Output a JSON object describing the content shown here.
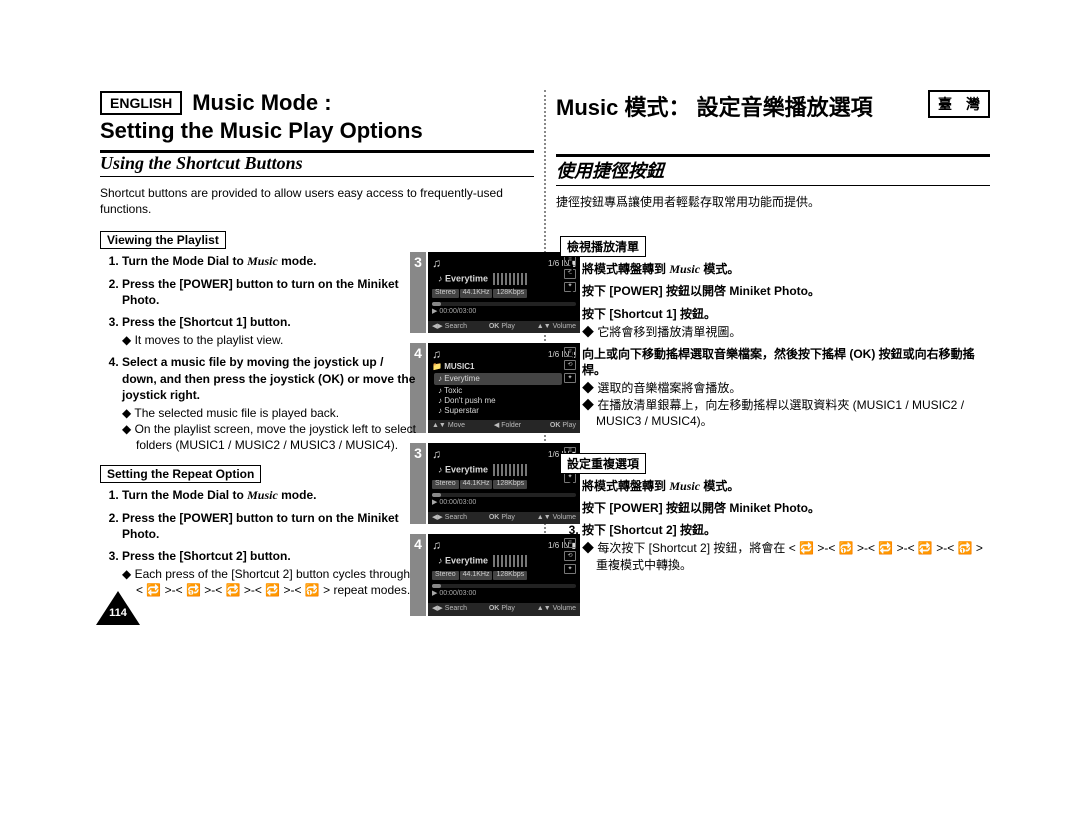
{
  "page_number": "114",
  "left": {
    "lang_tag": "ENGLISH",
    "title1": "Music Mode :",
    "title2": "Setting the Music Play Options",
    "subhead": "Using the Shortcut Buttons",
    "intro": "Shortcut buttons are provided to allow users easy access to frequently-used functions.",
    "sec1_label": "Viewing the Playlist",
    "sec1": {
      "s1": "Turn the Mode Dial to ",
      "s1_italic": "Music",
      "s1_tail": " mode.",
      "s2": "Press the [POWER] button to turn on the Miniket Photo.",
      "s3": "Press the [Shortcut 1] button.",
      "s3_sub1": "It moves to the playlist view.",
      "s4": "Select a music file by moving the joystick up / down, and then press the joystick (OK) or move the joystick right.",
      "s4_sub1": "The selected music file is played back.",
      "s4_sub2": "On the playlist screen, move the joystick left to select folders (MUSIC1 / MUSIC2 / MUSIC3 / MUSIC4)."
    },
    "sec2_label": "Setting the Repeat Option",
    "sec2": {
      "s1": "Turn the Mode Dial to ",
      "s1_italic": "Music",
      "s1_tail": " mode.",
      "s2": "Press the [POWER] button to turn on the Miniket Photo.",
      "s3": "Press the [Shortcut 2] button.",
      "s3_sub1": "Each press of the [Shortcut 2] button cycles through < 🔁 >-< 🔂 >-< 🔁 >-< 🔁 >-< 🔂 > repeat modes."
    }
  },
  "right": {
    "lang_tag": "臺　灣",
    "title1": "Music 模式： 設定音樂播放選項",
    "subhead": "使用捷徑按鈕",
    "intro": "捷徑按鈕專爲讓使用者輕鬆存取常用功能而提供。",
    "sec1_label": "檢視播放清單",
    "sec1": {
      "s1a": "將模式轉盤轉到 ",
      "s1_italic": "Music",
      "s1b": " 模式。",
      "s2": "按下 [POWER] 按鈕以開啓 Miniket Photo。",
      "s3": "按下 [Shortcut 1] 按鈕。",
      "s3_sub1": "它將會移到播放清單視圖。",
      "s4": "向上或向下移動搖桿選取音樂檔案，然後按下搖桿 (OK) 按鈕或向右移動搖桿。",
      "s4_sub1": "選取的音樂檔案將會播放。",
      "s4_sub2": "在播放清單銀幕上，向左移動搖桿以選取資料夾 (MUSIC1 / MUSIC2 / MUSIC3 / MUSIC4)。"
    },
    "sec2_label": "設定重複選項",
    "sec2": {
      "s1a": "將模式轉盤轉到 ",
      "s1_italic": "Music",
      "s1b": " 模式。",
      "s2": "按下 [POWER] 按鈕以開啓 Miniket Photo。",
      "s3": "按下 [Shortcut 2] 按鈕。",
      "s3_sub1": "每次按下 [Shortcut 2] 按鈕，將會在 < 🔁 >-< 🔂 >-< 🔁 >-< 🔁 >-< 🔂 > 重複模式中轉換。"
    }
  },
  "shots": {
    "n3": "3",
    "n4": "4",
    "counter": "1/6",
    "in": "IN",
    "track": "Everytime",
    "tag_stereo": "Stereo",
    "tag_rate": "44.1KHz",
    "tag_bit": "128Kbps",
    "time": "00:00/03:00",
    "bot_search": "Search",
    "bot_play": "Play",
    "bot_ok": "OK",
    "bot_volume": "Volume",
    "bot_move": "Move",
    "bot_folder": "Folder",
    "folder": "MUSIC1",
    "pl1": "Everytime",
    "pl2": "Toxic",
    "pl3": "Don't push me",
    "pl4": "Superstar"
  }
}
